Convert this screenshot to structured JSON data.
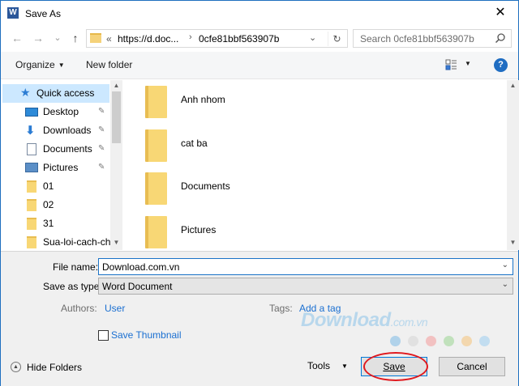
{
  "window": {
    "title": "Save As",
    "app_icon_letter": "W",
    "close_symbol": "✕"
  },
  "nav": {
    "back_arrow": "←",
    "forward_arrow": "→",
    "dropdown_arrow": "⌄",
    "up_arrow": "↑"
  },
  "address": {
    "overflow": "«",
    "segment1": "https://d.doc...",
    "segment2": "0cfe81bbf563907b",
    "separator": "›",
    "history_caret": "⌄",
    "refresh": "↻"
  },
  "search": {
    "placeholder": "Search 0cfe81bbf563907b"
  },
  "toolbar": {
    "organize": "Organize",
    "new_folder": "New folder",
    "help": "?"
  },
  "sidebar": {
    "items": [
      {
        "label": "Quick access",
        "icon": "star-icon",
        "pinned": false
      },
      {
        "label": "Desktop",
        "icon": "desktop-icon",
        "pinned": true
      },
      {
        "label": "Downloads",
        "icon": "download-icon",
        "pinned": true
      },
      {
        "label": "Documents",
        "icon": "documents-icon",
        "pinned": true
      },
      {
        "label": "Pictures",
        "icon": "pictures-icon",
        "pinned": true
      },
      {
        "label": "01",
        "icon": "folder-icon",
        "pinned": false
      },
      {
        "label": "02",
        "icon": "folder-icon",
        "pinned": false
      },
      {
        "label": "31",
        "icon": "folder-icon",
        "pinned": false
      },
      {
        "label": "Sua-loi-cach-ch",
        "icon": "folder-icon",
        "pinned": false
      }
    ],
    "pin_symbol": "📌"
  },
  "files": [
    {
      "name": "Anh nhom"
    },
    {
      "name": "cat ba"
    },
    {
      "name": "Documents"
    },
    {
      "name": "Pictures"
    }
  ],
  "form": {
    "file_name_label": "File name:",
    "file_name_value": "Download.com.vn",
    "save_type_label": "Save as type:",
    "save_type_value": "Word Document",
    "authors_label": "Authors:",
    "authors_value": "User",
    "tags_label": "Tags:",
    "tags_value": "Add a tag",
    "thumbnail_label": "Save Thumbnail",
    "thumbnail_checked": false
  },
  "footer": {
    "hide_folders": "Hide Folders",
    "tools": "Tools",
    "save": "Save",
    "cancel": "Cancel"
  },
  "watermark": {
    "main": "Download",
    "suffix": ".com.vn"
  },
  "colors": {
    "accent": "#0078d7",
    "selection": "#cce8ff",
    "folder": "#f8d775",
    "link": "#1a6fd1",
    "annotation": "#e0191e"
  }
}
